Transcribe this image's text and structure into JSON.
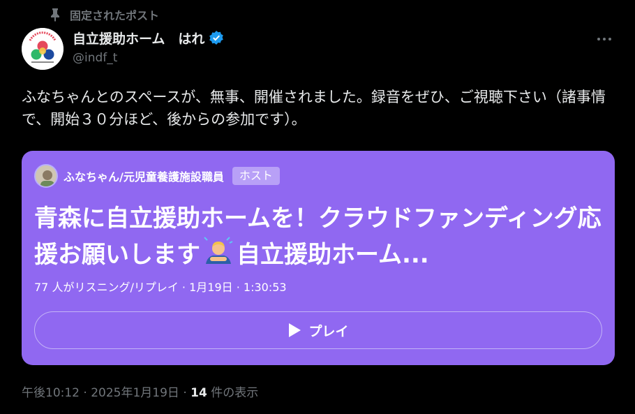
{
  "pinned": {
    "label": "固定されたポスト",
    "icon": "pin-icon"
  },
  "author": {
    "name": "自立援助ホーム　はれ",
    "handle": "@indf_t",
    "verified_icon": "verified-badge-icon",
    "avatar_icon": "org-logo-icon"
  },
  "more_icon": "more-options-icon",
  "post": {
    "text": "ふなちゃんとのスペースが、無事、開催されました。録音をぜひ、ご視聴下さい（諸事情で、開始３０分ほど、後からの参加です）。"
  },
  "space": {
    "host_name": "ふなちゃん/元児童養護施設職員",
    "host_badge": "ホスト",
    "title_part1": "青森に自立援助ホームを！クラウドファンディング応援お願いします",
    "title_part2": "自立援助ホーム...",
    "emoji_icon": "person-bowing-emoji-icon",
    "listeners": "77 人がリスニング/リプレイ · 1月19日 · 1:30:53",
    "play_label": "プレイ",
    "accent_color": "#9068f1"
  },
  "meta": {
    "timestamp": "午後10:12 · 2025年1月19日 · ",
    "views_count": "14",
    "views_label": " 件の表示"
  }
}
